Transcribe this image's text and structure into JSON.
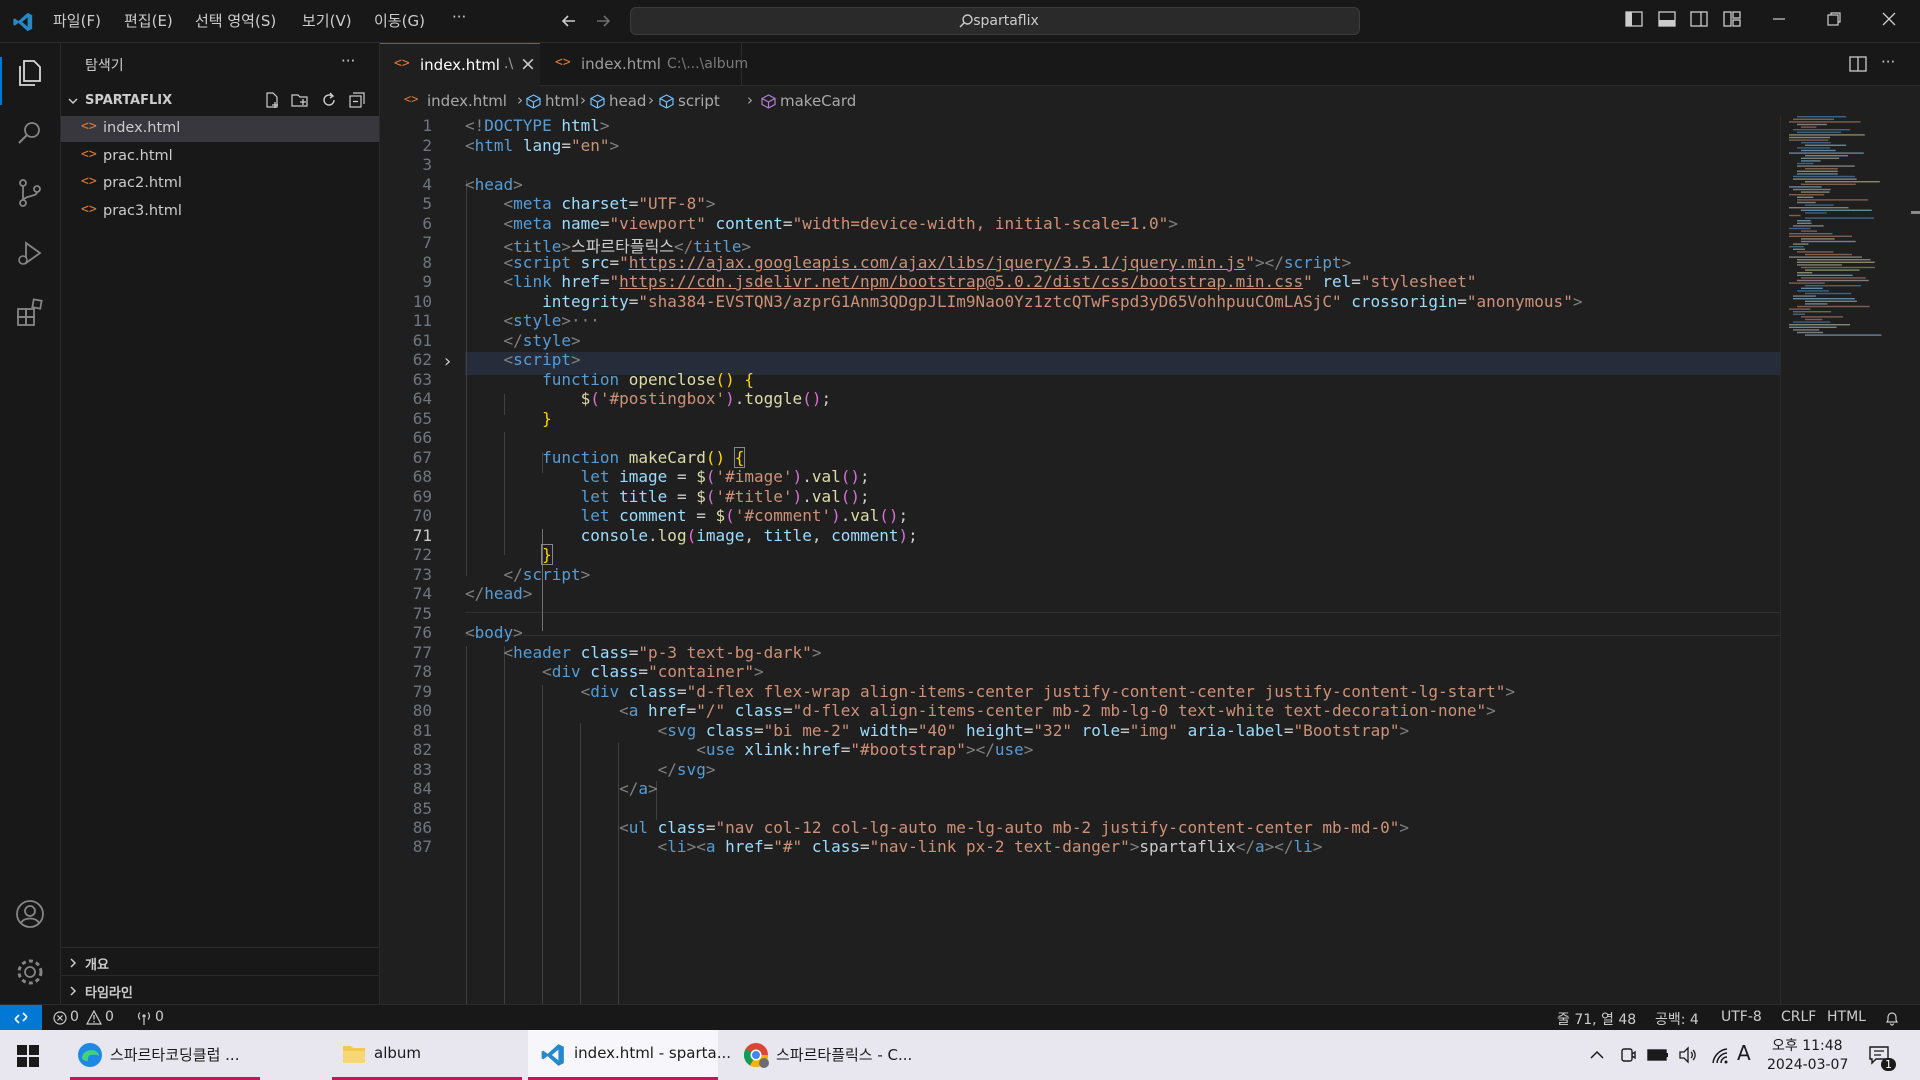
{
  "menu": [
    "파일(F)",
    "편집(E)",
    "선택 영역(S)",
    "보기(V)",
    "이동(G)",
    "···"
  ],
  "search": {
    "text": "spartaflix"
  },
  "sidebar": {
    "title": "탐색기",
    "more": "···",
    "folder": "SPARTAFLIX",
    "files": [
      "index.html",
      "prac.html",
      "prac2.html",
      "prac3.html"
    ],
    "bottom_sections": [
      "개요",
      "타임라인"
    ]
  },
  "tabs": [
    {
      "name": "index.html",
      "suffix": ".\\",
      "close": "×"
    },
    {
      "name": "index.html",
      "suffix": "C:\\...\\album"
    }
  ],
  "breadcrumb": [
    "index.html",
    "html",
    "head",
    "script",
    "makeCard"
  ],
  "editor": {
    "line_numbers": [
      "1",
      "2",
      "3",
      "4",
      "5",
      "6",
      "7",
      "8",
      "9",
      "10",
      "11",
      "61",
      "62",
      "63",
      "64",
      "65",
      "66",
      "67",
      "68",
      "69",
      "70",
      "71",
      "72",
      "73",
      "74",
      "75",
      "76",
      "77",
      "78",
      "79",
      "80",
      "81",
      "82",
      "83",
      "84",
      "85",
      "86",
      "87"
    ],
    "current_line": "71",
    "fold_marker": "›",
    "ellipsis": "···"
  },
  "status": {
    "errors": "0",
    "warnings": "0",
    "ports": "0",
    "position": "줄 71, 열 48",
    "spaces": "공백: 4",
    "encoding": "UTF-8",
    "eol": "CRLF",
    "language": "HTML"
  },
  "taskbar": {
    "items": [
      "스파르타코딩클럽 ...",
      "album",
      "index.html - sparta...",
      "스파르타플릭스 - C..."
    ],
    "time": "오후 11:48",
    "date": "2024-03-07",
    "ime": "A",
    "notif": "1"
  },
  "colors": {
    "accent": "#0078d4",
    "taskbar_marker": "#c2185b"
  }
}
